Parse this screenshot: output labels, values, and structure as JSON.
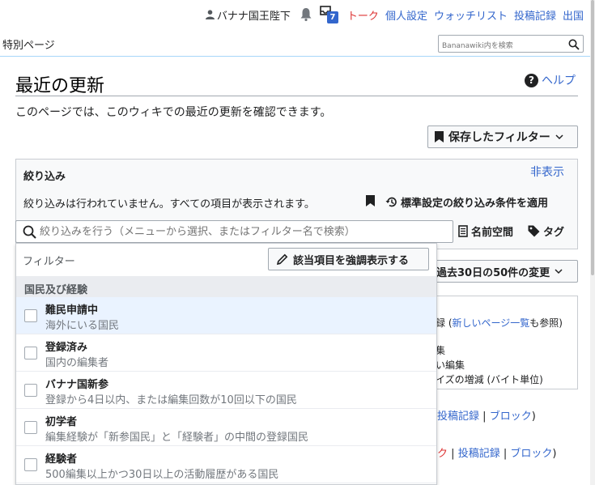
{
  "personal": {
    "user": "バナナ国王陛下",
    "notification_count": "7",
    "talk": "トーク",
    "preferences": "個人設定",
    "watchlist": "ウォッチリスト",
    "contributions": "投稿記録",
    "logout": "出国"
  },
  "tabs": {
    "special": "特別ページ"
  },
  "search": {
    "placeholder": "Bananawiki内を検索"
  },
  "page": {
    "title": "最近の更新",
    "help": "ヘルプ",
    "intro": "このページでは、このウィキでの最近の更新を確認できます。"
  },
  "saved_filters": "保存したフィルター",
  "filters": {
    "heading": "絞り込み",
    "hide": "非表示",
    "none_applied": "絞り込みは行われていません。すべての項目が表示されます。",
    "apply_default": "標準設定の絞り込み条件を適用",
    "input_placeholder": "絞り込みを行う（メニューから選択、またはフィルター名で検索）",
    "namespace": "名前空間",
    "tags": "タグ"
  },
  "background": {
    "limit": "過去30日の50件の変更",
    "legend_line1_a": "録 (",
    "legend_line1_link": "新しいページ一覧",
    "legend_line1_b": "も参照)",
    "legend_line2": "集",
    "legend_line3": "い編集",
    "legend_line4": "イズの増減 (バイト単位)",
    "row1_link1": "投稿記録",
    "row1_sep": "|",
    "row1_link2": "ブロック",
    "row1_end": ")",
    "row2_red": "ク",
    "row2_sep1": "|",
    "row2_link1": "投稿記録",
    "row2_sep2": "|",
    "row2_link2": "ブロック",
    "row2_end": ")"
  },
  "dropdown": {
    "filter_label": "フィルター",
    "highlight_button": "該当項目を強調表示する",
    "section": "国民及び経験",
    "options": [
      {
        "title": "難民申請中",
        "desc": "海外にいる国民"
      },
      {
        "title": "登録済み",
        "desc": "国内の編集者"
      },
      {
        "title": "バナナ国新参",
        "desc": "登録から4日以内、または編集回数が10回以下の国民"
      },
      {
        "title": "初学者",
        "desc": "編集経験が「新参国民」と「経験者」の中間の登録国民"
      },
      {
        "title": "経験者",
        "desc": "500編集以上かつ30日以上の活動履歴がある国民"
      }
    ]
  },
  "colors": {
    "link": "#3366cc",
    "talk": "#d33333",
    "highlight_row": "#eaf3ff",
    "badge": "#3366cc"
  }
}
